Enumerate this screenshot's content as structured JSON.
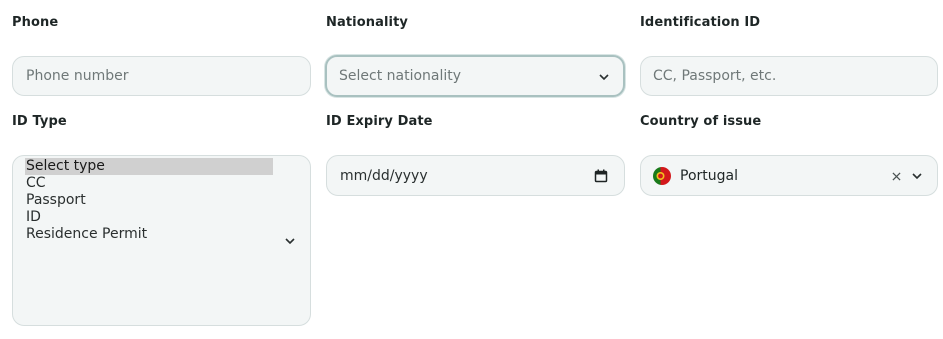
{
  "phone": {
    "label": "Phone",
    "placeholder": "Phone number"
  },
  "nationality": {
    "label": "Nationality",
    "placeholder": "Select nationality"
  },
  "identification": {
    "label": "Identification ID",
    "placeholder": "CC, Passport, etc."
  },
  "id_type": {
    "label": "ID Type",
    "options": [
      "Select type",
      "CC",
      "Passport",
      "ID",
      "Residence Permit"
    ],
    "selected": "Select type"
  },
  "expiry": {
    "label": "ID Expiry Date",
    "placeholder": "mm/dd/yyyy"
  },
  "country": {
    "label": "Country of issue",
    "value": "Portugal",
    "flag_icon": "portugal-flag-icon"
  },
  "colors": {
    "field_bg": "#f3f6f6",
    "field_border": "#d6dede",
    "focus_border": "#a9c1c0",
    "option_selected": "#d0d0d0"
  }
}
